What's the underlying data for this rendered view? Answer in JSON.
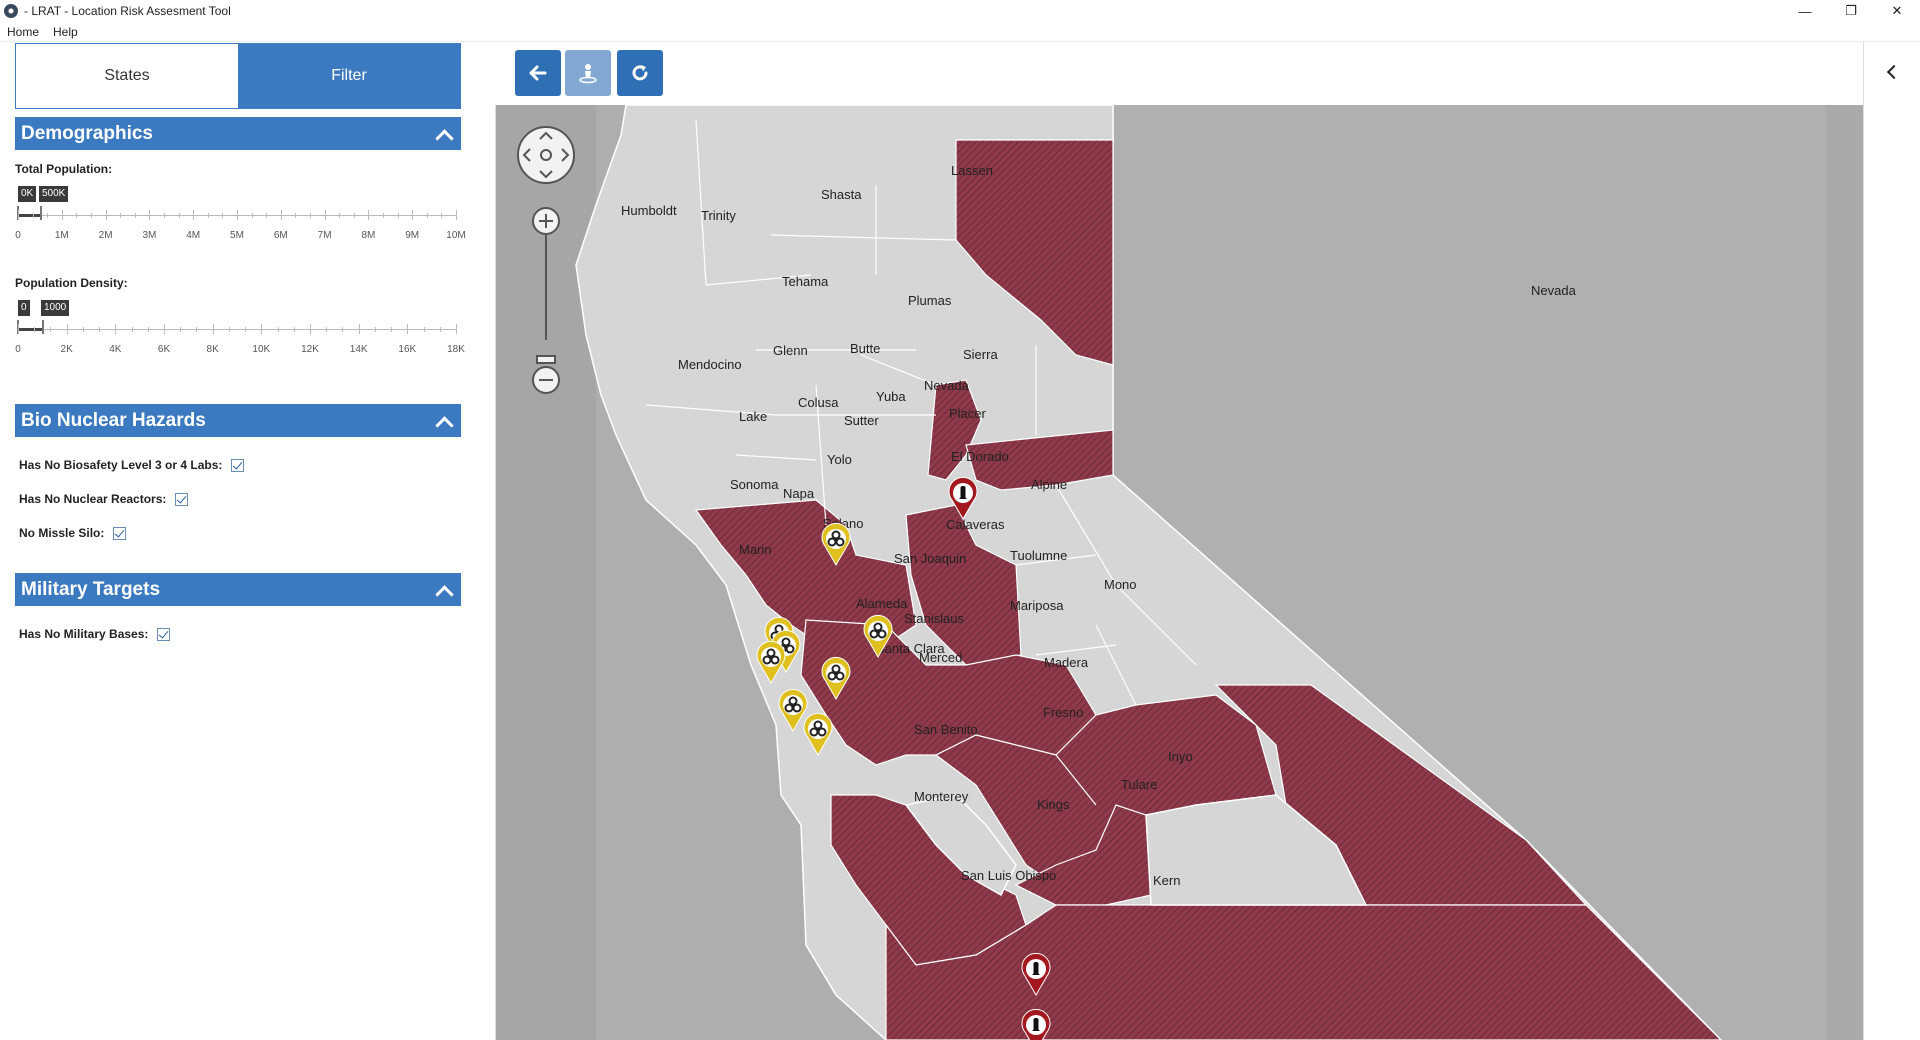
{
  "window": {
    "title": "- LRAT - Location Risk Assesment Tool",
    "minimize": "—",
    "restore": "❐",
    "close": "✕"
  },
  "menu": {
    "items": [
      "Home",
      "Help"
    ]
  },
  "tabs": {
    "states": "States",
    "filter": "Filter",
    "active": "Filter"
  },
  "demographics": {
    "title": "Demographics",
    "total_population": {
      "label": "Total Population:",
      "low_badge": "0K",
      "high_badge": "500K",
      "range_fraction": 0.05,
      "ticks": [
        "0",
        "1M",
        "2M",
        "3M",
        "4M",
        "5M",
        "6M",
        "7M",
        "8M",
        "9M",
        "10M"
      ]
    },
    "population_density": {
      "label": "Population Density:",
      "low_badge": "0",
      "high_badge": "1000",
      "range_fraction": 0.0556,
      "ticks": [
        "0",
        "2K",
        "4K",
        "6K",
        "8K",
        "10K",
        "12K",
        "14K",
        "16K",
        "18K"
      ]
    }
  },
  "bio_nuclear": {
    "title": "Bio Nuclear Hazards",
    "items": [
      {
        "label": "Has No Biosafety Level 3 or 4 Labs:",
        "checked": true
      },
      {
        "label": "Has No Nuclear Reactors:",
        "checked": true
      },
      {
        "label": "No Missle Silo:",
        "checked": true
      }
    ]
  },
  "military": {
    "title": "Military Targets",
    "items": [
      {
        "label": "Has No Military Bases:",
        "checked": true
      }
    ]
  },
  "toolbar": {
    "back_icon": "arrow-left-icon",
    "locate_icon": "person-pin-icon",
    "refresh_icon": "refresh-icon"
  },
  "map": {
    "state_label": "Nevada",
    "counties": [
      "Humboldt",
      "Trinity",
      "Shasta",
      "Lassen",
      "Tehama",
      "Plumas",
      "Mendocino",
      "Glenn",
      "Butte",
      "Sierra",
      "Nevada",
      "Yuba",
      "Lake",
      "Colusa",
      "Sutter",
      "Placer",
      "Yolo",
      "El Dorado",
      "Alpine",
      "Sonoma",
      "Napa",
      "Solano",
      "Marin",
      "Calaveras",
      "Tuolumne",
      "Mono",
      "San Joaquin",
      "Alameda",
      "Stanislaus",
      "Mariposa",
      "Santa Clara",
      "Merced",
      "Madera",
      "Fresno",
      "San Benito",
      "Inyo",
      "Monterey",
      "Kings",
      "Tulare",
      "San Luis Obispo",
      "Kern"
    ],
    "colors": {
      "risk": "#8e3a4b",
      "safe": "#d6d6d6",
      "background": "#aeaeae",
      "biohazard_pin": "#e0c01f",
      "silo_pin": "#a3181f"
    }
  }
}
